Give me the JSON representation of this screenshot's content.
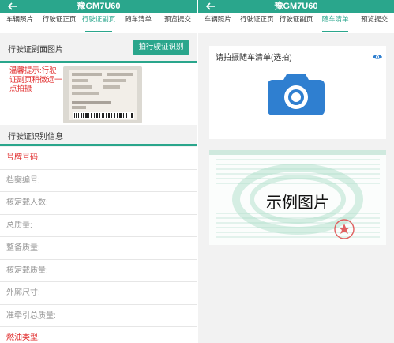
{
  "left": {
    "title": "豫GM7U60",
    "tabs": [
      {
        "label": "车辆照片"
      },
      {
        "label": "行驶证正页"
      },
      {
        "label": "行驶证副页",
        "active": true
      },
      {
        "label": "随车清单"
      },
      {
        "label": "预览提交"
      }
    ],
    "section_label": "行驶证副面图片",
    "ocr_button": "拍行驶证识别",
    "tip": "温馨提示:行驶证副页稍微远一点拍摄",
    "info_label": "行驶证识别信息",
    "fields": [
      {
        "label": "号牌号码:",
        "required": true
      },
      {
        "label": "档案编号:",
        "required": false
      },
      {
        "label": "核定载人数:",
        "required": false
      },
      {
        "label": "总质量:",
        "required": false
      },
      {
        "label": "整备质量:",
        "required": false
      },
      {
        "label": "核定载质量:",
        "required": false
      },
      {
        "label": "外廓尺寸:",
        "required": false
      },
      {
        "label": "准牵引总质量:",
        "required": false
      },
      {
        "label": "燃油类型:",
        "required": true
      }
    ]
  },
  "right": {
    "title": "豫GM7U60",
    "tabs": [
      {
        "label": "车辆照片"
      },
      {
        "label": "行驶证正页"
      },
      {
        "label": "行驶证副页"
      },
      {
        "label": "随车清单",
        "active": true
      },
      {
        "label": "预览提交"
      }
    ],
    "photo_label": "请拍摄随车清单(选拍)",
    "sample_caption": "示例图片"
  },
  "colors": {
    "primary": "#2aa68c",
    "required": "#e02a2a",
    "camera": "#2f7fd0"
  },
  "icons": {
    "back": "arrow-left-icon",
    "eye": "eye-icon",
    "camera": "camera-icon"
  }
}
